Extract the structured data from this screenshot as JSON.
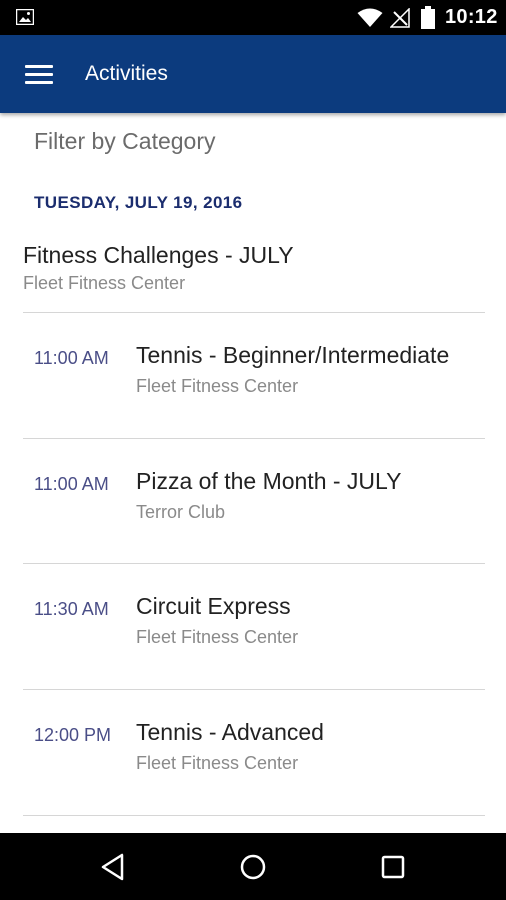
{
  "status_bar": {
    "time": "10:12",
    "icons": [
      "image-notification-icon",
      "wifi-icon",
      "no-signal-icon",
      "battery-icon"
    ]
  },
  "app_bar": {
    "title": "Activities",
    "menu_icon": "hamburger-menu-icon",
    "background": "#0c3b7e"
  },
  "filter": {
    "label": "Filter by Category"
  },
  "schedule": {
    "date": "TUESDAY, JULY 19, 2016",
    "all_day": {
      "name": "Fitness Challenges - JULY",
      "location": "Fleet Fitness Center"
    },
    "events": [
      {
        "time": "11:00 AM",
        "name": "Tennis - Beginner/Intermediate",
        "location": "Fleet Fitness Center"
      },
      {
        "time": "11:00 AM",
        "name": "Pizza of the Month - JULY",
        "location": "Terror Club"
      },
      {
        "time": "11:30 AM",
        "name": "Circuit Express",
        "location": "Fleet Fitness Center"
      },
      {
        "time": "12:00 PM",
        "name": "Tennis - Advanced",
        "location": "Fleet Fitness Center"
      }
    ]
  },
  "nav_bar": {
    "buttons": [
      "back-icon",
      "home-icon",
      "recents-icon"
    ]
  },
  "colors": {
    "date_header": "#1b2d6e",
    "time_text": "#4a4e87",
    "secondary_text": "#8a8a8a"
  }
}
